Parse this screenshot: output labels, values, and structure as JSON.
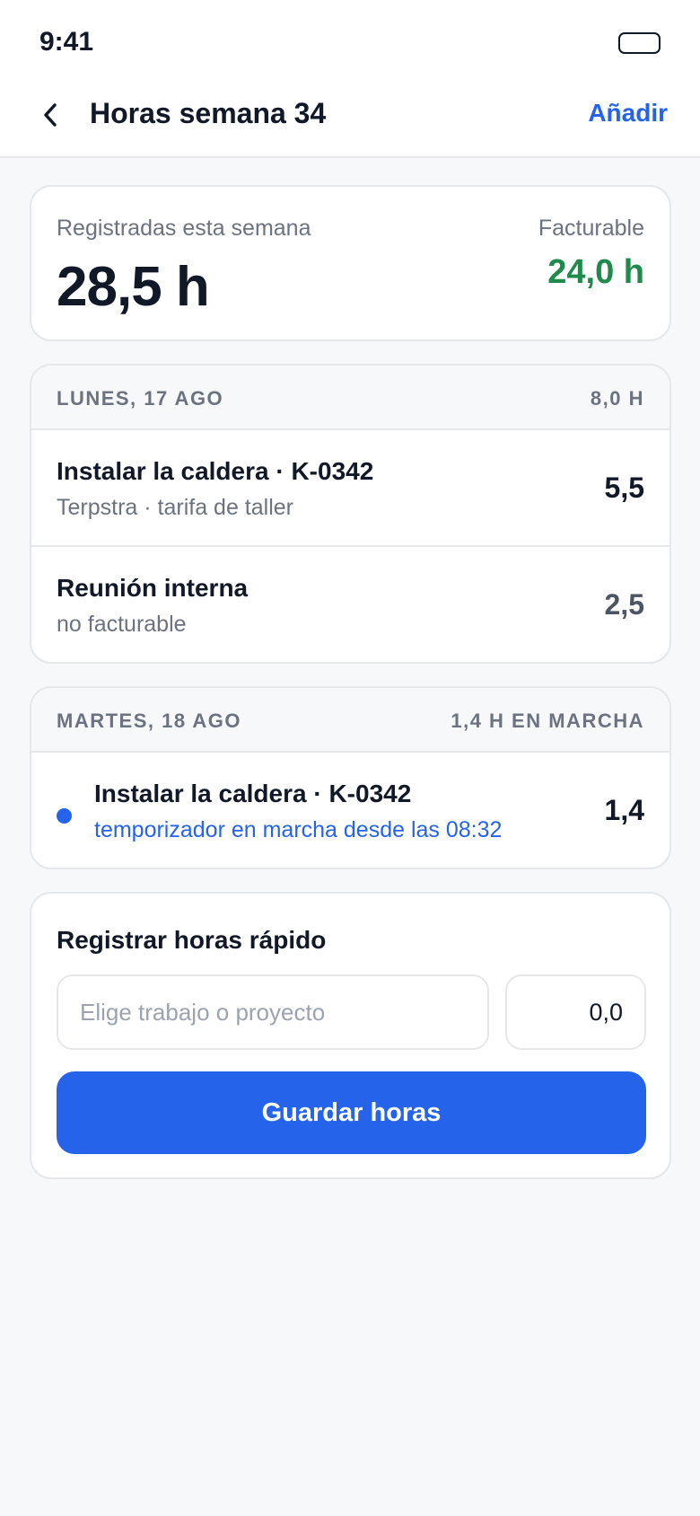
{
  "status_bar": {
    "time": "9:41"
  },
  "nav": {
    "title": "Horas semana 34",
    "add_label": "Añadir"
  },
  "summary": {
    "label": "Registradas esta semana",
    "total": "28,5 h",
    "billable_label": "Facturable",
    "billable_value": "24,0 h"
  },
  "days": [
    {
      "title": "LUNES, 17 AGO",
      "total": "8,0 H",
      "entries": [
        {
          "title": "Instalar la caldera · K-0342",
          "subtitle": "Terpstra · tarifa de taller",
          "hours": "5,5"
        },
        {
          "title": "Reunión interna",
          "subtitle": "no facturable",
          "hours": "2,5"
        }
      ]
    },
    {
      "title": "MARTES, 18 AGO",
      "total": "1,4 H EN MARCHA",
      "entries": [
        {
          "title": "Instalar la caldera · K-0342",
          "subtitle": "temporizador en marcha desde las 08:32",
          "hours": "1,4"
        }
      ]
    }
  ],
  "quick_log": {
    "title": "Registrar horas rápido",
    "job_placeholder": "Elige trabajo o proyecto",
    "hours_value": "0,0",
    "save_label": "Guardar horas"
  },
  "colors": {
    "accent": "#2563eb",
    "billable": "#1f8a4c",
    "muted_text": "#6b7280",
    "background": "#f7f8fa"
  },
  "icons": {
    "back": "chevron-left-icon",
    "battery": "battery-icon",
    "running": "running-dot-icon"
  }
}
